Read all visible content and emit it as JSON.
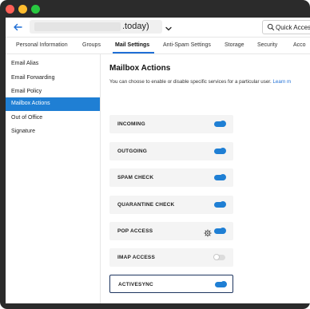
{
  "window": {
    "controls": [
      "close",
      "minimize",
      "maximize"
    ]
  },
  "topbar": {
    "url_suffix": ".today)",
    "quick_access_label": "Quick Access",
    "icons": [
      "back-arrow-icon",
      "chevron-down-icon",
      "search-icon"
    ]
  },
  "tabs": [
    {
      "label": "Personal Information"
    },
    {
      "label": "Groups"
    },
    {
      "label": "Mail Settings"
    },
    {
      "label": "Anti-Spam Settings"
    },
    {
      "label": "Storage"
    },
    {
      "label": "Security"
    },
    {
      "label": "Acco"
    }
  ],
  "active_tab": "Mail Settings",
  "sidebar": {
    "items": [
      {
        "label": "Email Alias"
      },
      {
        "label": "Email Forwarding"
      },
      {
        "label": "Email Policy"
      },
      {
        "label": "Mailbox Actions"
      },
      {
        "label": "Out of Office"
      },
      {
        "label": "Signature"
      }
    ],
    "active": "Mailbox Actions"
  },
  "main": {
    "title": "Mailbox Actions",
    "description": "You can choose to enable or disable specific services for a particular user.",
    "description_link": "Learn m",
    "actions": [
      {
        "label": "INCOMING",
        "enabled": true
      },
      {
        "label": "OUTGOING",
        "enabled": true
      },
      {
        "label": "SPAM CHECK",
        "enabled": true
      },
      {
        "label": "QUARANTINE CHECK",
        "enabled": true
      },
      {
        "label": "POP ACCESS",
        "enabled": true,
        "icon": "gear-icon"
      },
      {
        "label": "IMAP ACCESS",
        "enabled": false
      },
      {
        "label": "ACTIVESYNC",
        "enabled": true,
        "selected": true
      }
    ]
  },
  "colors": {
    "accent": "#1f7fd4",
    "frame": "#2b2b2b",
    "row_background": "#f4f4f4",
    "selected_border": "#1e3560"
  }
}
